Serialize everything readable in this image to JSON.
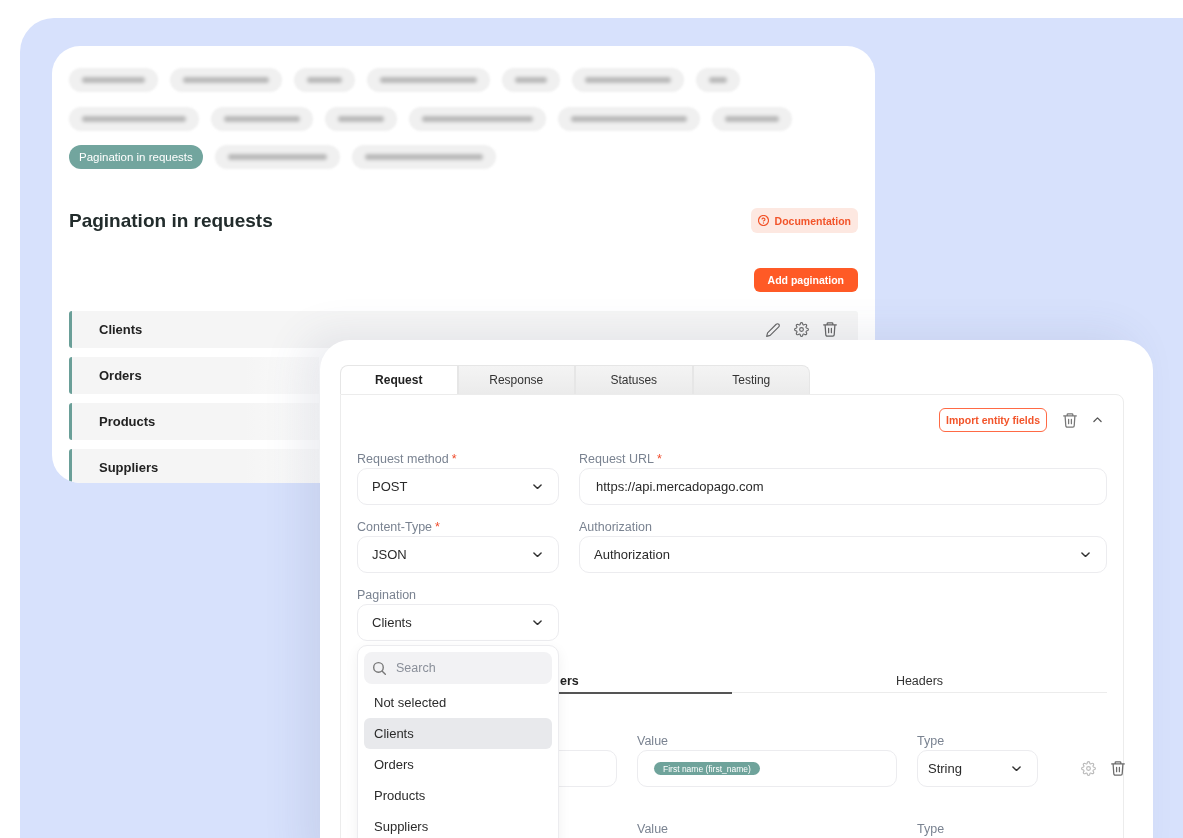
{
  "settings_card": {
    "tags": [
      {
        "kind": "blurred",
        "selected": false
      },
      {
        "kind": "blurred",
        "selected": false
      },
      {
        "kind": "blurred",
        "selected": false
      },
      {
        "kind": "blurred",
        "selected": false
      },
      {
        "kind": "blurred",
        "selected": false
      },
      {
        "kind": "blurred",
        "selected": false
      },
      {
        "kind": "blurred",
        "selected": false
      },
      {
        "kind": "blurred",
        "selected": false
      },
      {
        "kind": "blurred",
        "selected": false
      },
      {
        "kind": "blurred",
        "selected": false
      },
      {
        "kind": "blurred",
        "selected": false
      },
      {
        "kind": "blurred",
        "selected": false
      },
      {
        "kind": "blurred",
        "selected": false
      },
      {
        "kind": "chip",
        "label": "Pagination in requests",
        "selected": true
      },
      {
        "kind": "blurred",
        "selected": false
      },
      {
        "kind": "blurred",
        "selected": false
      }
    ],
    "title": "Pagination in requests",
    "documentation_button": "Documentation",
    "add_button": "Add pagination",
    "paginations": [
      {
        "name": "Clients"
      },
      {
        "name": "Orders"
      },
      {
        "name": "Products"
      },
      {
        "name": "Suppliers"
      }
    ]
  },
  "request_editor": {
    "tabs": [
      {
        "label": "Request",
        "selected": true
      },
      {
        "label": "Response",
        "selected": false
      },
      {
        "label": "Statuses",
        "selected": false
      },
      {
        "label": "Testing",
        "selected": false
      }
    ],
    "import_button": "Import entity fields",
    "fields": [
      {
        "label": "Request method",
        "required_mark": "*",
        "kind": "select",
        "value": "POST"
      },
      {
        "label": "Request URL",
        "required_mark": "*",
        "kind": "input",
        "value": "https://api.mercadopago.com"
      },
      {
        "label": "Content-Type",
        "required_mark": "*",
        "kind": "select",
        "value": "JSON"
      },
      {
        "label": "Authorization",
        "kind": "select",
        "value": "Authorization"
      },
      {
        "label": "Pagination",
        "kind": "select",
        "value": "Clients",
        "dropdown": {
          "search_placeholder": "Search",
          "options": [
            {
              "label": "Not selected",
              "selected": false
            },
            {
              "label": "Clients",
              "selected": true
            },
            {
              "label": "Orders",
              "selected": false
            },
            {
              "label": "Products",
              "selected": false
            },
            {
              "label": "Suppliers",
              "selected": false
            }
          ]
        }
      }
    ],
    "sub_tabs": [
      {
        "label": "ers",
        "selected": true
      },
      {
        "label": "Headers",
        "selected": false
      }
    ],
    "parameter_rows": [
      {
        "value_label": "Value",
        "value_tag": "First name (first_name)",
        "type_label": "Type",
        "type": "String"
      },
      {
        "value_label": "Value",
        "type_label": "Type"
      }
    ]
  }
}
